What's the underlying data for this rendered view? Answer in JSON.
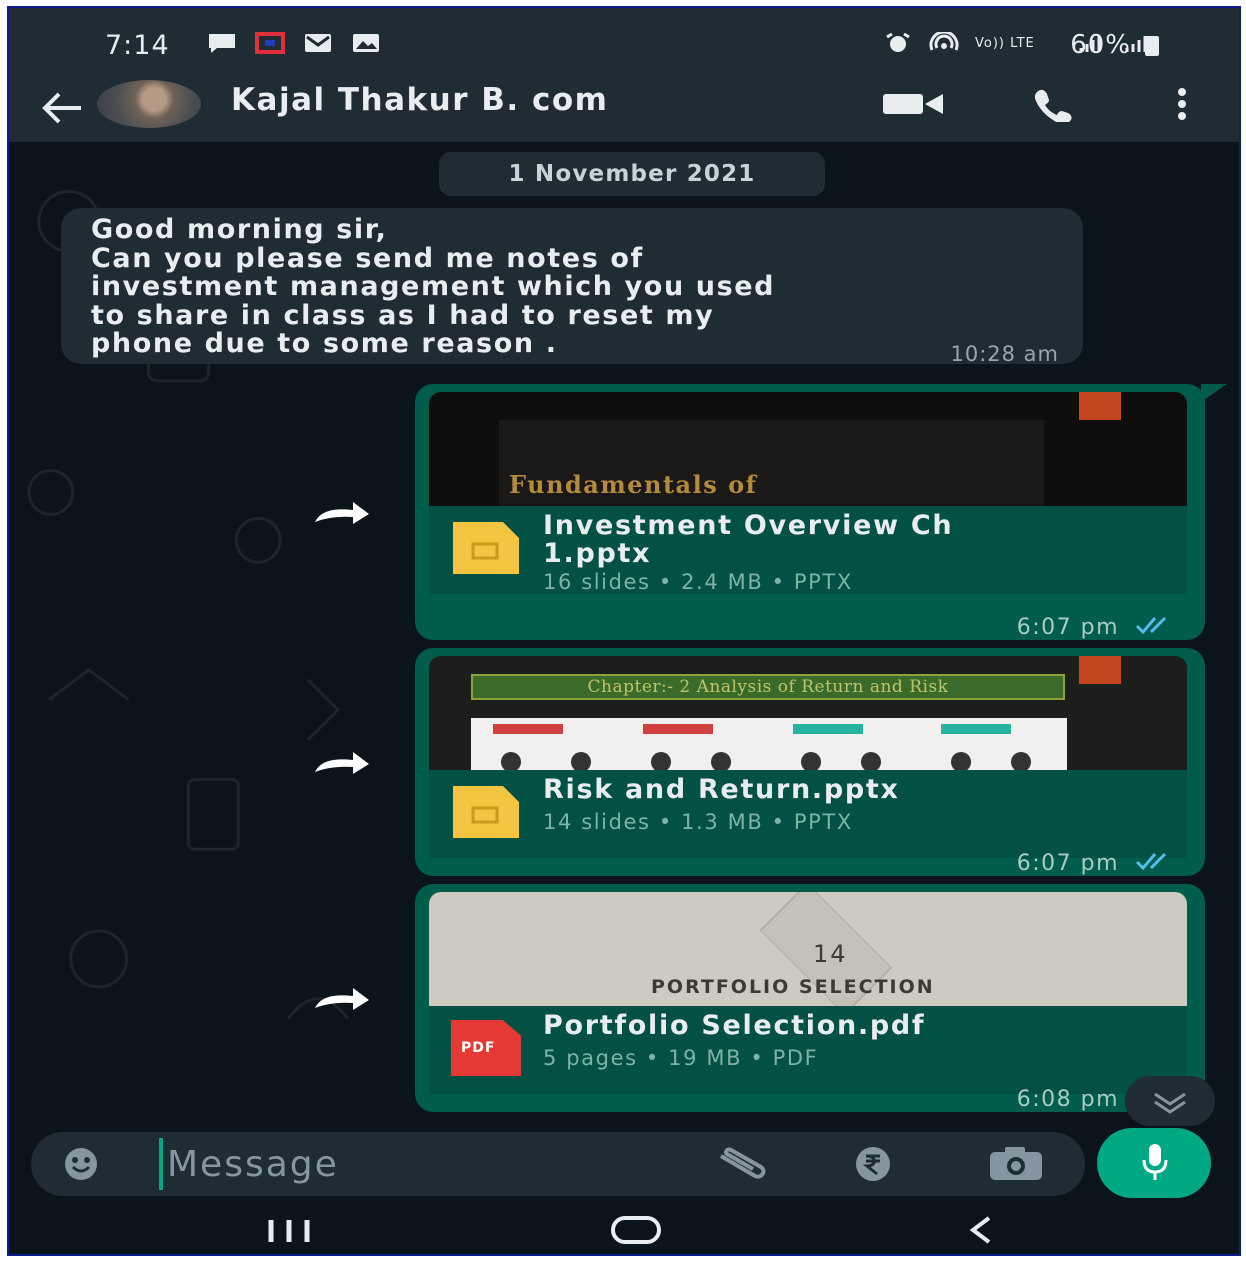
{
  "status_bar": {
    "time": "7:14",
    "battery": "60%",
    "network_label": "Vo)) LTE"
  },
  "header": {
    "contact_name": "Kajal Thakur B. com"
  },
  "date_chip": "1 November 2021",
  "messages": {
    "incoming": {
      "text": "Good morning sir,\nCan you please send me notes of\ninvestment management which you used\nto share in class as I had to reset my\nphone due to some reason .",
      "time": "10:28 am"
    },
    "files": [
      {
        "preview_title": "Fundamentals of",
        "name": "Investment Overview Ch\n1.pptx",
        "meta": "16 slides • 2.4 MB • PPTX",
        "time": "6:07 pm",
        "type": "PPTX"
      },
      {
        "preview_title": "Chapter:- 2 Analysis of Return and Risk",
        "name": "Risk and Return.pptx",
        "meta": "14 slides • 1.3 MB • PPTX",
        "time": "6:07 pm",
        "type": "PPTX"
      },
      {
        "preview_number": "14",
        "preview_title": "PORTFOLIO SELECTION",
        "name": "Portfolio Selection.pdf",
        "meta": "5 pages • 19 MB • PDF",
        "time": "6:08 pm",
        "type": "PDF",
        "icon_label": "PDF"
      }
    ]
  },
  "composer": {
    "placeholder": "Message"
  },
  "colors": {
    "chat_bg": "#0b141a",
    "bar_bg": "#1f2c34",
    "outgoing_bubble": "#005c4b",
    "accent": "#00a884",
    "read_ticks": "#53bdeb"
  }
}
